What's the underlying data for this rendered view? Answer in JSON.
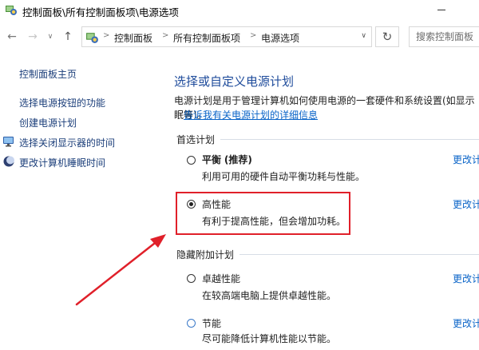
{
  "window": {
    "title": "控制面板\\所有控制面板项\\电源选项"
  },
  "address": {
    "crumbs": [
      "控制面板",
      "所有控制面板项",
      "电源选项"
    ],
    "search_placeholder": "搜索控制面板"
  },
  "sidebar": {
    "home": "控制面板主页",
    "items": [
      {
        "label": "选择电源按钮的功能",
        "icon": "none"
      },
      {
        "label": "创建电源计划",
        "icon": "none"
      },
      {
        "label": "选择关闭显示器的时间",
        "icon": "monitor-icon"
      },
      {
        "label": "更改计算机睡眠时间",
        "icon": "moon-icon"
      }
    ]
  },
  "main": {
    "heading": "选择或自定义电源计划",
    "description": "电源计划是用于管理计算机如何使用电源的一套硬件和系统设置(如显示",
    "description_cont": "眠等)。",
    "description_link": "告诉我有关电源计划的详细信息",
    "preferred_label": "首选计划",
    "hidden_label": "隐藏附加计划",
    "change_link": "更改计",
    "plans": [
      {
        "name": "平衡",
        "tag": "(推荐)",
        "desc": "利用可用的硬件自动平衡功耗与性能。",
        "selected": false
      },
      {
        "name": "高性能",
        "tag": "",
        "desc": "有利于提高性能，但会增加功耗。",
        "selected": true
      },
      {
        "name": "卓越性能",
        "tag": "",
        "desc": "在较高端电脑上提供卓越性能。",
        "selected": false
      },
      {
        "name": "节能",
        "tag": "",
        "desc": "尽可能降低计算机性能以节能。",
        "selected": false
      }
    ]
  },
  "colors": {
    "heading": "#1e4b9b",
    "link": "#0a64c8",
    "highlight": "#e0202a"
  }
}
